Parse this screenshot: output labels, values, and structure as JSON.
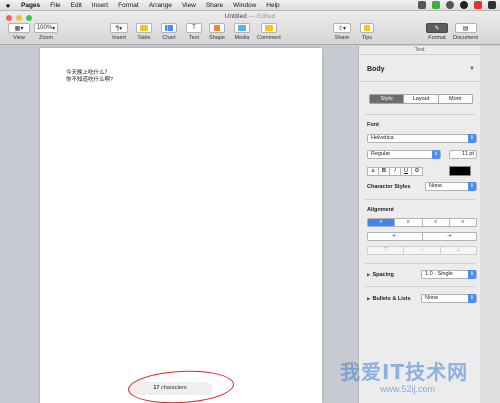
{
  "menubar": {
    "apple": "",
    "items": [
      "Pages",
      "File",
      "Edit",
      "Insert",
      "Format",
      "Arrange",
      "View",
      "Share",
      "Window",
      "Help"
    ]
  },
  "window": {
    "title": "Untitled",
    "edited": "— Edited"
  },
  "toolbar": {
    "view": "View",
    "zoom": "Zoom",
    "zoom_value": "100%",
    "insert": "Insert",
    "table": "Table",
    "chart": "Chart",
    "text": "Text",
    "shape": "Shape",
    "media": "Media",
    "comment": "Comment",
    "share": "Share",
    "tips": "Tips",
    "format": "Format",
    "document": "Document"
  },
  "document": {
    "lines": [
      "今天晚上吃什么？",
      "你不知道吃什么啊?"
    ],
    "counter_number": "17",
    "counter_label": "characters"
  },
  "inspector": {
    "header": "Text",
    "paragraph_style": "Body",
    "tabs": [
      "Style",
      "Layout",
      "More"
    ],
    "active_tab": "Style",
    "font_title": "Font",
    "font_name": "Helvetica",
    "font_style": "Regular",
    "font_size": "11 pt",
    "format_buttons": [
      "a",
      "B",
      "I",
      "U",
      "⚙"
    ],
    "char_styles_label": "Character Styles",
    "char_styles_value": "None",
    "alignment_title": "Alignment",
    "align_buttons": [
      "≡",
      "≡",
      "≡",
      "≡"
    ],
    "indent_buttons": [
      "⇤",
      "⇥"
    ],
    "spacing_label": "Spacing",
    "spacing_value": "1.0 - Single",
    "bullets_label": "Bullets & Lists",
    "bullets_value": "None"
  },
  "watermark": {
    "text": "我爱IT技术网",
    "url": "www.52ij.com"
  },
  "colors": {
    "accent": "#3b86f0",
    "annotation": "#e0241c"
  }
}
